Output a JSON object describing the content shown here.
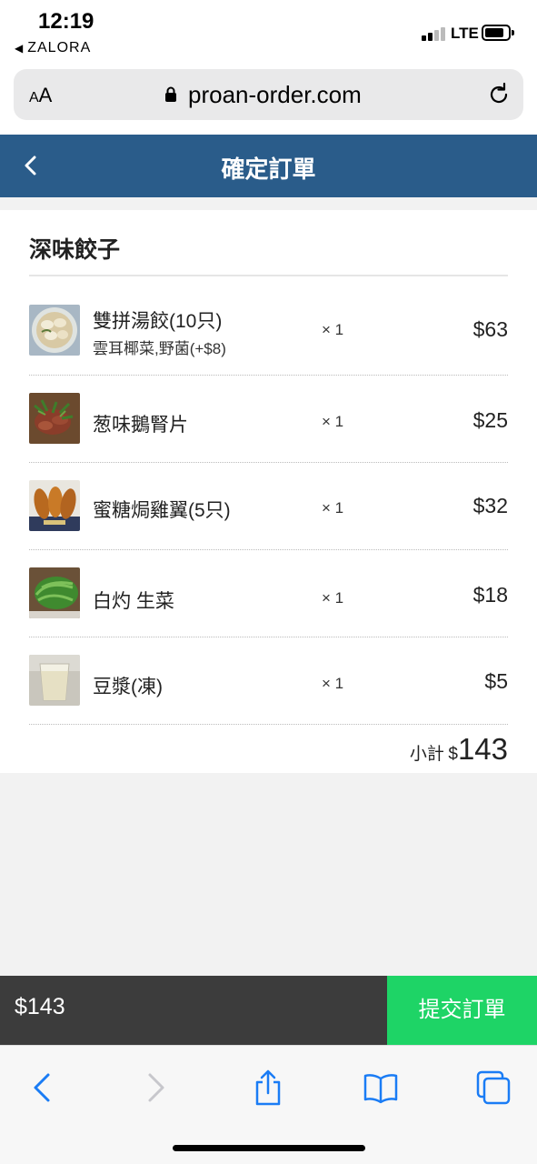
{
  "status_bar": {
    "time": "12:19",
    "back_app": "ZALORA",
    "carrier_type": "LTE"
  },
  "browser": {
    "text_size_label_small": "A",
    "text_size_label_large": "A",
    "url": "proan-order.com"
  },
  "header": {
    "title": "確定訂單",
    "background_color": "#2a5c8a"
  },
  "order": {
    "shop_name": "深味餃子",
    "items": [
      {
        "name": "雙拼湯餃(10只)",
        "option": "雲耳椰菜,野菌(+$8)",
        "qty": "× 1",
        "price": "$63"
      },
      {
        "name": "葱味鵝腎片",
        "qty": "× 1",
        "price": "$25"
      },
      {
        "name": "蜜糖焗雞翼(5只)",
        "qty": "× 1",
        "price": "$32"
      },
      {
        "name": "白灼 生菜",
        "qty": "× 1",
        "price": "$18"
      },
      {
        "name": "豆漿(凍)",
        "qty": "× 1",
        "price": "$5"
      }
    ],
    "subtotal_label": "小計",
    "subtotal_currency": "$",
    "subtotal_amount": "143"
  },
  "checkout": {
    "total": "$143",
    "submit_label": "提交訂單",
    "submit_color": "#1ed466"
  },
  "toolbar": {
    "icons": [
      "back-icon",
      "forward-icon",
      "share-icon",
      "bookmarks-icon",
      "tabs-icon"
    ],
    "accent_color": "#1a7cf5"
  }
}
